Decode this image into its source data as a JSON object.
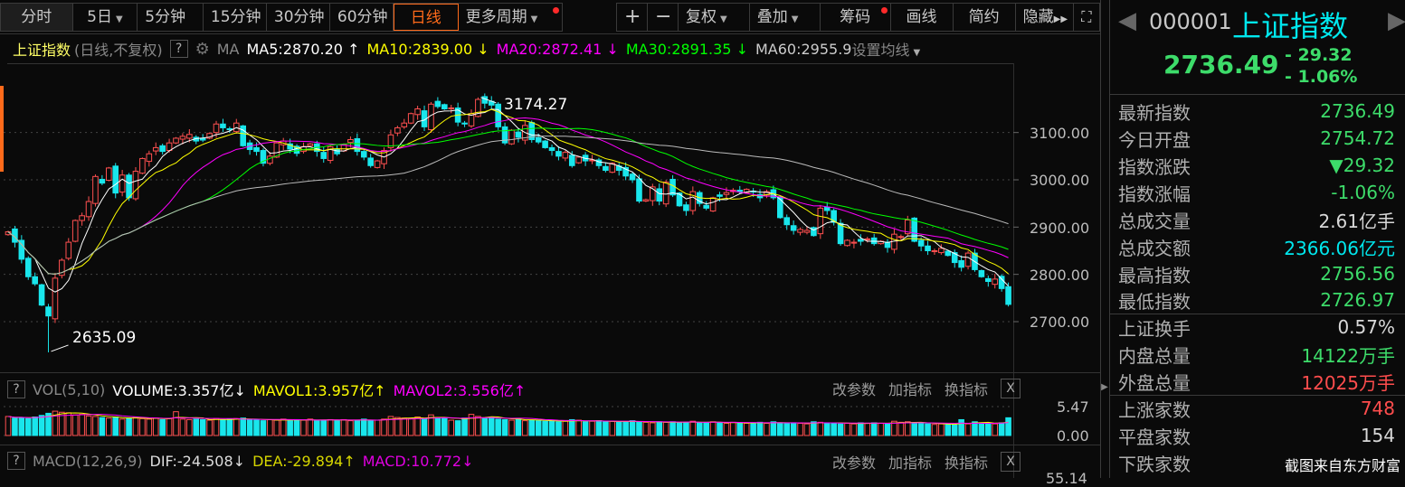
{
  "toolbar": {
    "periods": [
      "分时",
      "5日",
      "5分钟",
      "15分钟",
      "30分钟",
      "60分钟",
      "日线",
      "更多周期"
    ],
    "active_period": "日线",
    "tools": [
      "+",
      "−",
      "复权",
      "叠加",
      "筹码",
      "画线",
      "简约",
      "隐藏"
    ],
    "fullscreen_icon": "expand-icon"
  },
  "legend": {
    "name": "上证指数",
    "mode": "(日线,不复权)",
    "help": "?",
    "ma_label": "MA",
    "ma5": "MA5:2870.20",
    "ma10": "MA10:2839.00",
    "ma20": "MA20:2872.41",
    "ma30": "MA30:2891.35",
    "ma60": "MA60:2955.9",
    "settings": "设置均线",
    "arrow_up": "↑",
    "arrow_down": "↓"
  },
  "colors": {
    "up": "#ff5050",
    "down": "#19e6ec",
    "ma5": "#ffffff",
    "ma10": "#ffff00",
    "ma20": "#ff00ff",
    "ma30": "#00ff00",
    "ma60": "#bbbbbb",
    "accent": "#ff6a1a"
  },
  "chart_data": {
    "type": "candlestick",
    "y_ticks": [
      "3100.00",
      "3000.00",
      "2900.00",
      "2800.00",
      "2700.00"
    ],
    "ylim": [
      2620,
      3200
    ],
    "closes": [
      2890,
      2868,
      2832,
      2795,
      2780,
      2735,
      2712,
      2792,
      2830,
      2868,
      2914,
      2924,
      2954,
      3007,
      2993,
      3025,
      2972,
      3010,
      2962,
      3018,
      3045,
      3055,
      3068,
      3060,
      3078,
      3088,
      3092,
      3096,
      3082,
      3084,
      3098,
      3118,
      3110,
      3106,
      3120,
      3072,
      3064,
      3060,
      3035,
      3050,
      3078,
      3082,
      3065,
      3056,
      3070,
      3076,
      3060,
      3045,
      3070,
      3055,
      3075,
      3085,
      3060,
      3048,
      3030,
      3040,
      3062,
      3095,
      3110,
      3120,
      3140,
      3150,
      3112,
      3160,
      3155,
      3150,
      3152,
      3122,
      3118,
      3140,
      3170,
      3162,
      3158,
      3112,
      3078,
      3105,
      3090,
      3115,
      3085,
      3080,
      3068,
      3062,
      3050,
      3058,
      3030,
      3048,
      3040,
      3042,
      3030,
      3020,
      3035,
      3020,
      3008,
      3000,
      2955,
      2958,
      2985,
      2955,
      2995,
      2968,
      2945,
      2935,
      2975,
      2950,
      2940,
      2962,
      2965,
      2973,
      2978,
      2975,
      2980,
      2975,
      2962,
      2975,
      2962,
      2920,
      2905,
      2893,
      2895,
      2893,
      2882,
      2940,
      2935,
      2910,
      2865,
      2872,
      2868,
      2870,
      2875,
      2865,
      2870,
      2857,
      2885,
      2880,
      2915,
      2870,
      2860,
      2850,
      2850,
      2855,
      2840,
      2825,
      2815,
      2845,
      2810,
      2795,
      2785,
      2790,
      2770,
      2736.49
    ],
    "annotations": [
      {
        "index": 6,
        "kind": "low",
        "label": "2635.09",
        "value": 2635.09
      },
      {
        "index": 70,
        "kind": "high",
        "label": "3174.27",
        "value": 3174.27
      }
    ],
    "volume": {
      "header": "VOL(5,10)",
      "volume_label": "VOLUME:3.357亿",
      "mavol1_label": "MAVOL1:3.957亿",
      "mavol2_label": "MAVOL2:3.556亿",
      "y_ticks": [
        "5.47",
        "0.00"
      ],
      "ymax": 5.47,
      "values": [
        3.6,
        3.3,
        3.4,
        3.2,
        3.5,
        3.8,
        4.2,
        4.6,
        4.4,
        4.3,
        3.9,
        4.0,
        3.7,
        3.6,
        3.4,
        3.3,
        3.5,
        3.1,
        3.3,
        3.4,
        3.2,
        3.1,
        3.3,
        3.0,
        3.2,
        4.5,
        3.1,
        3.0,
        3.1,
        3.0,
        2.9,
        3.2,
        3.0,
        3.1,
        3.2,
        3.3,
        3.0,
        2.9,
        2.8,
        3.0,
        2.9,
        3.1,
        2.8,
        3.0,
        2.9,
        3.1,
        2.8,
        2.9,
        3.0,
        2.9,
        3.0,
        2.8,
        2.9,
        3.1,
        2.8,
        2.9,
        3.1,
        3.6,
        3.4,
        3.3,
        3.2,
        3.5,
        3.1,
        3.9,
        3.4,
        3.3,
        2.9,
        2.8,
        3.3,
        4.0,
        3.6,
        3.3,
        3.5,
        3.1,
        3.0,
        2.9,
        3.2,
        2.8,
        2.9,
        2.8,
        2.7,
        2.8,
        2.6,
        2.7,
        3.0,
        2.9,
        2.6,
        2.7,
        2.8,
        2.6,
        2.7,
        2.5,
        2.6,
        2.8,
        2.6,
        2.5,
        2.4,
        2.6,
        2.5,
        2.6,
        2.4,
        2.5,
        2.7,
        2.4,
        2.5,
        2.6,
        2.4,
        2.3,
        2.5,
        2.4,
        2.3,
        2.4,
        2.5,
        2.3,
        2.6,
        2.4,
        2.3,
        2.4,
        2.3,
        2.2,
        2.6,
        2.5,
        2.4,
        2.3,
        2.2,
        2.3,
        2.2,
        2.4,
        2.3,
        2.4,
        2.3,
        2.2,
        2.7,
        2.5,
        2.6,
        2.4,
        2.3,
        2.2,
        2.1,
        2.2,
        2.1,
        2.0,
        3.0,
        2.2,
        2.6,
        2.4,
        2.3,
        2.2,
        2.4,
        3.357
      ]
    },
    "macd": {
      "header": "MACD(12,26,9)",
      "dif": "DIF:-24.508",
      "dea": "DEA:-29.894",
      "macd": "MACD:10.772",
      "y_tick": "55.14"
    }
  },
  "sub_buttons": [
    "改参数",
    "加指标",
    "换指标"
  ],
  "close_label": "X",
  "quote": {
    "code": "000001",
    "name": "上证指数",
    "price": "2736.49",
    "change": "- 29.32",
    "change_pct": "- 1.06%",
    "rows": [
      {
        "label": "最新指数",
        "value": "2736.49",
        "tone": "g"
      },
      {
        "label": "今日开盘",
        "value": "2754.72",
        "tone": "g"
      },
      {
        "label": "指数涨跌",
        "value": "▼29.32",
        "tone": "g"
      },
      {
        "label": "指数涨幅",
        "value": "-1.06%",
        "tone": "g"
      },
      {
        "label": "总成交量",
        "value": "2.61亿手",
        "tone": "w"
      },
      {
        "label": "总成交额",
        "value": "2366.06亿元",
        "tone": "c"
      },
      {
        "label": "最高指数",
        "value": "2756.56",
        "tone": "g"
      },
      {
        "label": "最低指数",
        "value": "2726.97",
        "tone": "g"
      },
      {
        "label": "上证换手",
        "value": "0.57%",
        "tone": "w"
      },
      {
        "label": "内盘总量",
        "value": "14122万手",
        "tone": "g"
      },
      {
        "label": "外盘总量",
        "value": "12025万手",
        "tone": "r"
      },
      {
        "label": "上涨家数",
        "value": "748",
        "tone": "r"
      },
      {
        "label": "平盘家数",
        "value": "154",
        "tone": "w"
      },
      {
        "label": "下跌家数",
        "value": "",
        "tone": "g"
      }
    ],
    "watermark": "截图来自东方财富"
  }
}
